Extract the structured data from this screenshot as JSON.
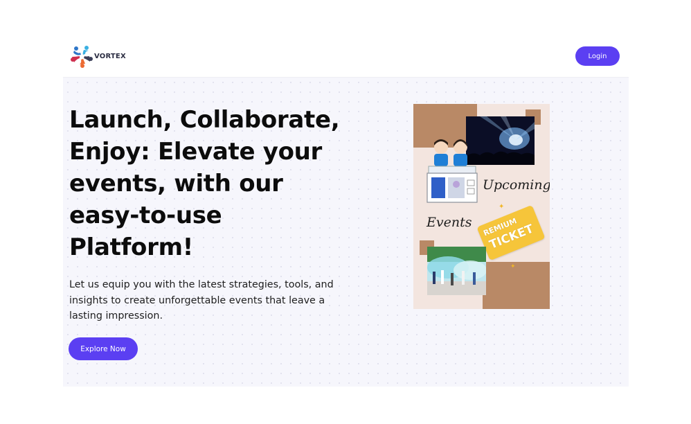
{
  "header": {
    "brand": "VORTEX",
    "login_label": "Login"
  },
  "hero": {
    "headline_lines": [
      "Launch, Collaborate,",
      "Enjoy: Elevate your",
      "events, with our",
      "easy-to-use",
      "Platform!"
    ],
    "subtext_lines": [
      "Let us equip you with the latest strategies, tools, and",
      "insights to create unforgettable events that leave a",
      "lasting impression."
    ],
    "cta_label": "Explore Now"
  },
  "poster": {
    "script_line1": "Upcoming",
    "script_line2": "Events",
    "ticket_line1": "REMIUM",
    "ticket_line2": "TICKET"
  },
  "colors": {
    "accent": "#5b3ff2",
    "hero_bg": "#f6f6fc",
    "poster_bg": "#f3e5df",
    "poster_block": "#b98966",
    "ticket": "#f6c53a"
  },
  "icons": {
    "logo": "people-circle-logo-icon"
  }
}
